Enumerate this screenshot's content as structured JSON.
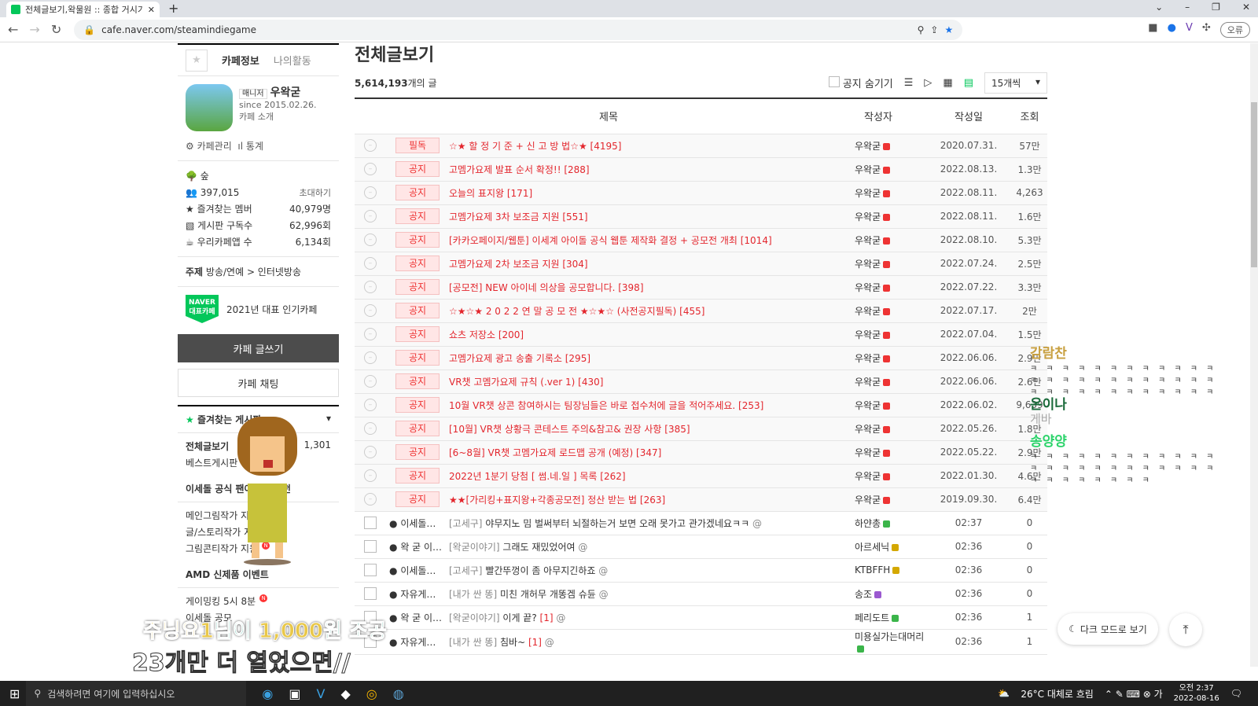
{
  "browser": {
    "tab_title": "전체글보기,왁물원 :: 종합 거시기",
    "url": "cafe.naver.com/steamindiegame",
    "profile_label": "오류"
  },
  "sidebar": {
    "tab_info": "카페정보",
    "tab_activity": "나의활동",
    "manager_label": "매니저",
    "manager_name": "우왁굳",
    "since": "since 2015.02.26.",
    "intro": "카페 소개",
    "admin": "카페관리",
    "stats_link": "통계",
    "level": "숲",
    "members": "397,015",
    "invite": "초대하기",
    "stats": [
      {
        "label": "즐겨찾는 멤버",
        "value": "40,979명"
      },
      {
        "label": "게시판 구독수",
        "value": "62,996회"
      },
      {
        "label": "우리카페앱 수",
        "value": "6,134회"
      }
    ],
    "topic_label": "주제",
    "topic": "방송/연예 > 인터넷방송",
    "award_badge": "NAVER 대표카페",
    "award": "2021년 대표 인기카페",
    "write": "카페 글쓰기",
    "chat": "카페 채팅",
    "fav_header": "즐겨찾는 게시판",
    "all_posts": "전체글보기",
    "all_count": "1,301",
    "best": "베스트게시판",
    "section1": "이세돌 공식 팬아트 공모전",
    "items1": [
      "메인그림작가 지원",
      "글/스토리작가 지원",
      "그림콘티작가 지원"
    ],
    "section2": "AMD 신제품 이벤트",
    "items2": [
      "게이밍킹 5시 8분"
    ],
    "items3": [
      "이세돌 공모"
    ]
  },
  "main": {
    "title": "전체글보기",
    "count": "5,614,193",
    "count_suffix": "개의 글",
    "hide_notice": "공지 숨기기",
    "per_page": "15개씩",
    "headers": {
      "title": "제목",
      "author": "작성자",
      "date": "작성일",
      "views": "조회"
    },
    "notices": [
      {
        "badge": "필독",
        "title": "☆★ 할 정 기 준 + 신 고 방 법☆★ [4195]",
        "author": "우왁굳",
        "date": "2020.07.31.",
        "views": "57만"
      },
      {
        "badge": "공지",
        "title": "고멤가요제 발표 순서 확정!! [288]",
        "author": "우왁굳",
        "date": "2022.08.13.",
        "views": "1.3만"
      },
      {
        "badge": "공지",
        "title": "오늘의 표지왕 [171]",
        "author": "우왁굳",
        "date": "2022.08.11.",
        "views": "4,263"
      },
      {
        "badge": "공지",
        "title": "고멤가요제 3차 보조금 지원 [551]",
        "author": "우왁굳",
        "date": "2022.08.11.",
        "views": "1.6만"
      },
      {
        "badge": "공지",
        "title": "[카카오페이지/웹툰] 이세계 아이돌 공식 웹툰 제작화 결정 + 공모전 개최 [1014]",
        "author": "우왁굳",
        "date": "2022.08.10.",
        "views": "5.3만"
      },
      {
        "badge": "공지",
        "title": "고멤가요제 2차 보조금 지원 [304]",
        "author": "우왁굳",
        "date": "2022.07.24.",
        "views": "2.5만"
      },
      {
        "badge": "공지",
        "title": "[공모전] NEW 아이네 의상을 공모합니다. [398]",
        "author": "우왁굳",
        "date": "2022.07.22.",
        "views": "3.3만"
      },
      {
        "badge": "공지",
        "title": "☆★☆★ 2 0 2 2 연 말 공 모 전 ★☆★☆ (사전공지필독) [455]",
        "author": "우왁굳",
        "date": "2022.07.17.",
        "views": "2만"
      },
      {
        "badge": "공지",
        "title": "쇼츠 저장소 [200]",
        "author": "우왁굳",
        "date": "2022.07.04.",
        "views": "1.5만"
      },
      {
        "badge": "공지",
        "title": "고멤가요제 광고 송출 기록소 [295]",
        "author": "우왁굳",
        "date": "2022.06.06.",
        "views": "2.9만"
      },
      {
        "badge": "공지",
        "title": "VR챗 고멤가요제 규칙 (.ver 1) [430]",
        "author": "우왁굳",
        "date": "2022.06.06.",
        "views": "2.6만"
      },
      {
        "badge": "공지",
        "title": "10월 VR챗 상콘 참여하시는 팀장님들은 바로 접수처에 글을 적어주세요. [253]",
        "author": "우왁굳",
        "date": "2022.06.02.",
        "views": "9,639"
      },
      {
        "badge": "공지",
        "title": "[10월] VR챗 상황극 콘테스트 주의&참고& 권장 사항 [385]",
        "author": "우왁굳",
        "date": "2022.05.26.",
        "views": "1.8만"
      },
      {
        "badge": "공지",
        "title": "[6~8월] VR챗 고멤가요제 로드맵 공개 (예정) [347]",
        "author": "우왁굳",
        "date": "2022.05.22.",
        "views": "2.9만"
      },
      {
        "badge": "공지",
        "title": "2022년 1분기 당첨 [ 썸.네.일 ] 목록 [262]",
        "author": "우왁굳",
        "date": "2022.01.30.",
        "views": "4.6만"
      },
      {
        "badge": "공지",
        "title": "★★[가리킹+표지왕+각종공모전] 정산 받는 법 [263]",
        "author": "우왁굳",
        "date": "2019.09.30.",
        "views": "6.4만"
      }
    ],
    "posts": [
      {
        "board": "이세돌…",
        "cat": "[고세구]",
        "title": "야무지노 밈 벌써부터 뇌절하는거 보면 오래 못가고 관가겠네요ㅋㅋ",
        "comments": "",
        "author": "하얀총",
        "time": "02:37",
        "views": "0",
        "lvl": "#3bb54a"
      },
      {
        "board": "왁 굳 이…",
        "cat": "[왁굳이야기]",
        "title": "그래도 재밌었어여",
        "comments": "",
        "author": "아르세닉",
        "time": "02:36",
        "views": "0",
        "lvl": "#d4a800"
      },
      {
        "board": "이세돌…",
        "cat": "[고세구]",
        "title": "빨간뚜껑이 좀 아무지긴하죠",
        "comments": "",
        "author": "KTBFFH",
        "time": "02:36",
        "views": "0",
        "lvl": "#d4a800"
      },
      {
        "board": "자유게…",
        "cat": "[내가 싼 똥]",
        "title": "미친 개허무 개똥겜 슈듄",
        "comments": "",
        "author": "송조",
        "time": "02:36",
        "views": "0",
        "lvl": "#9b59d0"
      },
      {
        "board": "왁 굳 이…",
        "cat": "[왁굳이야기]",
        "title": "이게 끝?",
        "comments": "[1]",
        "author": "페리도트",
        "time": "02:36",
        "views": "1",
        "lvl": "#3bb54a"
      },
      {
        "board": "자유게…",
        "cat": "[내가 싼 똥]",
        "title": "침바~",
        "comments": "[1]",
        "author": "미용실가는대머리",
        "time": "02:36",
        "views": "1",
        "lvl": "#3bb54a"
      }
    ]
  },
  "overlay": {
    "donation_name": "주닝요1",
    "donation_mid": "님이 ",
    "donation_amount": "1,000",
    "donation_end": "원 조공",
    "donation_msg": "23개만 더 열었으면//",
    "chat": [
      {
        "name": "감람찬",
        "color": "#c8a040",
        "msg": "ㅋ ㅋ ㅋ ㅋ ㅋ ㅋ ㅋ ㅋ ㅋ ㅋ ㅋ ㅋ ㅋ ㅋ ㅋ ㅋ ㅋ ㅋ ㅋ ㅋ ㅋ ㅋ ㅋ ㅋ ㅋ ㅋ ㅋ ㅋ ㅋ ㅋ ㅋ ㅋ ㅋ ㅋ ㅋ ㅋ"
      },
      {
        "name": "온이나",
        "color": "#1a6a3a",
        "msg": "게바"
      },
      {
        "name": "송양양",
        "color": "#2bd36a",
        "msg": "ㅋ ㅋ ㅋ ㅋ ㅋ ㅋ ㅋ ㅋ ㅋ ㅋ ㅋ ㅋ ㅋ ㅋ ㅋ ㅋ ㅋ ㅋ ㅋ ㅋ ㅋ ㅋ ㅋ ㅋ ㅋ ㅋ ㅋ ㅋ ㅋ ㅋ ㅋ ㅋ"
      }
    ]
  },
  "floating": {
    "dark_mode": "다크 모드로 보기"
  },
  "taskbar": {
    "search_placeholder": "검색하려면 여기에 입력하십시오",
    "weather": "26°C 대체로 흐림",
    "time": "오전 2:37",
    "date": "2022-08-16"
  }
}
